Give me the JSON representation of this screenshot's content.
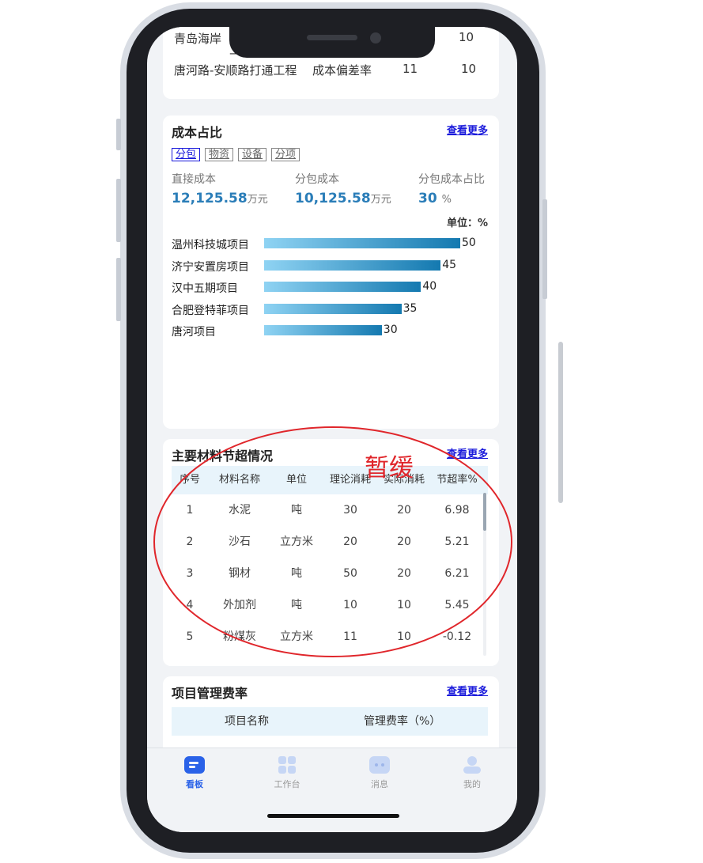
{
  "top_table": {
    "rows": [
      {
        "name": "青岛海岸",
        "name2": "工",
        "a": "",
        "b": "10"
      },
      {
        "name": "唐河路-安顺路打通工程",
        "metric": "成本偏差率",
        "a": "11",
        "b": "10"
      }
    ]
  },
  "cost_share": {
    "title": "成本占比",
    "more": "查看更多",
    "tabs": [
      "分包",
      "物资",
      "设备",
      "分项"
    ],
    "stats": [
      {
        "label": "直接成本",
        "value": "12,125.58",
        "unit": "万元"
      },
      {
        "label": "分包成本",
        "value": "10,125.58",
        "unit": "万元"
      },
      {
        "label": "分包成本占比",
        "value": "30",
        "unit": "%"
      }
    ],
    "unit_label": "单位：%"
  },
  "chart_data": {
    "type": "bar",
    "orientation": "horizontal",
    "categories": [
      "温州科技城项目",
      "济宁安置房项目",
      "汉中五期项目",
      "合肥登特菲项目",
      "唐河项目"
    ],
    "values": [
      50,
      45,
      40,
      35,
      30
    ],
    "ylabel": "单位：%",
    "xlim": [
      0,
      50
    ],
    "colors": [
      "#8fd3f3",
      "#1479b0"
    ]
  },
  "materials": {
    "title": "主要材料节超情况",
    "stamp": "暂缓",
    "more": "查看更多",
    "columns": [
      "序号",
      "材料名称",
      "单位",
      "理论消耗",
      "实际消耗",
      "节超率%"
    ],
    "rows": [
      [
        "1",
        "水泥",
        "吨",
        "30",
        "20",
        "6.98"
      ],
      [
        "2",
        "沙石",
        "立方米",
        "20",
        "20",
        "5.21"
      ],
      [
        "3",
        "钢材",
        "吨",
        "50",
        "20",
        "6.21"
      ],
      [
        "4",
        "外加剂",
        "吨",
        "10",
        "10",
        "5.45"
      ],
      [
        "5",
        "粉煤灰",
        "立方米",
        "11",
        "10",
        "-0.12"
      ]
    ]
  },
  "mgmt_fee": {
    "title": "项目管理费率",
    "more": "查看更多",
    "columns": [
      "项目名称",
      "管理费率（%）"
    ]
  },
  "tabbar": {
    "items": [
      {
        "label": "看板",
        "icon": "dashboard-icon",
        "active": true
      },
      {
        "label": "工作台",
        "icon": "workbench-icon",
        "active": false
      },
      {
        "label": "消息",
        "icon": "message-icon",
        "active": false
      },
      {
        "label": "我的",
        "icon": "profile-icon",
        "active": false
      }
    ],
    "active_color": "#2a62e8"
  }
}
